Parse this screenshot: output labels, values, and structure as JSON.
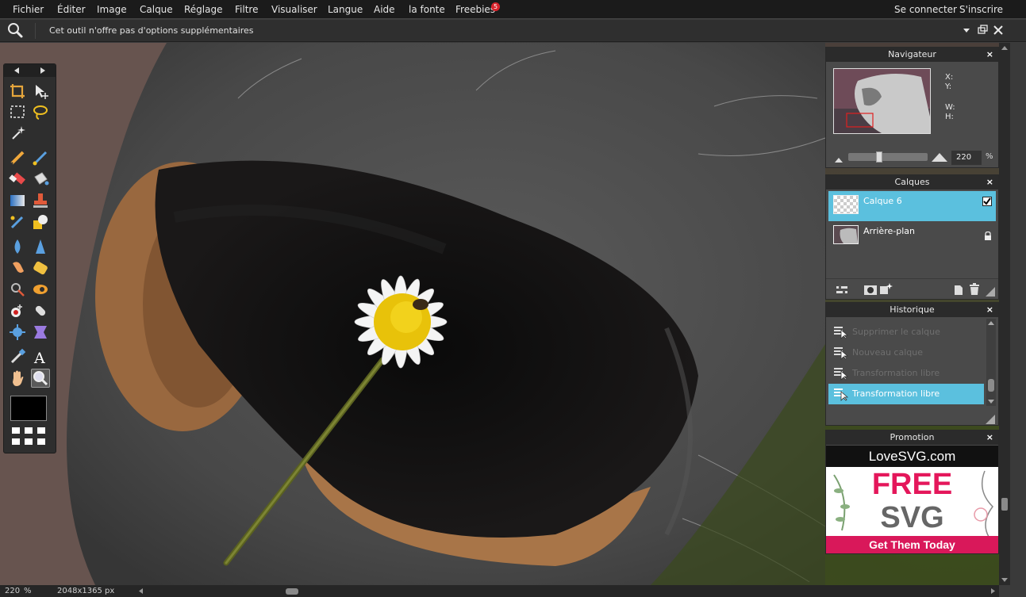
{
  "menu": {
    "items": [
      "Fichier",
      "Éditer",
      "Image",
      "Calque",
      "Réglage",
      "Filtre",
      "Visualiser",
      "Langue",
      "Aide",
      "la fonte",
      "Freebies"
    ],
    "freebies_badge": "5",
    "login": "Se connecter",
    "signup": "S'inscrire"
  },
  "options": {
    "message": "Cet outil n'offre pas d'options supplémentaires"
  },
  "navigator": {
    "title": "Navigateur",
    "close": "×",
    "x_label": "X:",
    "y_label": "Y:",
    "w_label": "W:",
    "h_label": "H:",
    "zoom_value": "220",
    "zoom_unit": "%"
  },
  "layers": {
    "title": "Calques",
    "close": "×",
    "items": [
      {
        "name": "Calque 6",
        "selected": true
      },
      {
        "name": "Arrière-plan",
        "selected": false
      }
    ]
  },
  "history": {
    "title": "Historique",
    "close": "×",
    "items": [
      {
        "label": "Supprimer le calque",
        "selected": false
      },
      {
        "label": "Nouveau calque",
        "selected": false
      },
      {
        "label": "Transformation libre",
        "selected": false
      },
      {
        "label": "Transformation libre",
        "selected": true
      }
    ]
  },
  "promotion": {
    "title": "Promotion",
    "close": "×",
    "brand": "LoveSVG.com",
    "headline1": "FREE",
    "headline2": "SVG",
    "cta": "Get Them Today"
  },
  "status": {
    "zoom": "220",
    "zoom_unit": "%",
    "dimensions": "2048x1365 px"
  },
  "colors": {
    "selection": "#5bc0de",
    "badge": "#d9232b",
    "promo_pink": "#e4175b"
  }
}
